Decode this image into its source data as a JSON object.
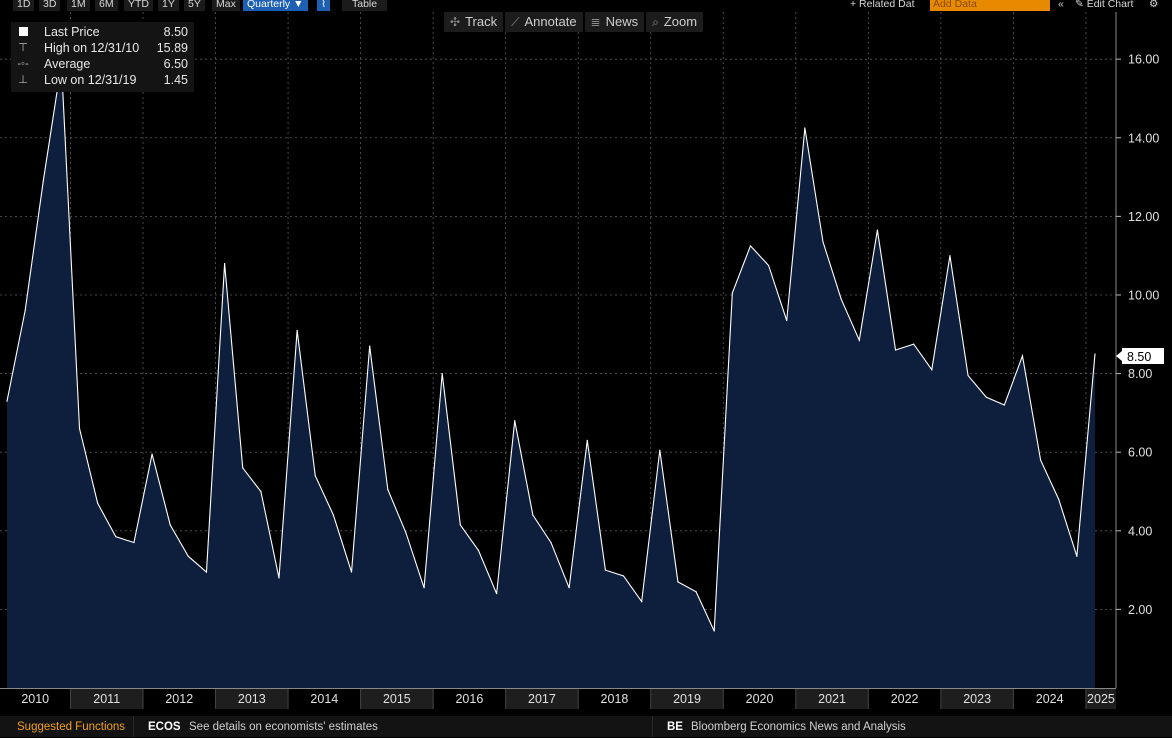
{
  "toolbar": {
    "ranges": [
      "1D",
      "3D",
      "1M",
      "6M",
      "YTD",
      "1Y",
      "5Y",
      "Max"
    ],
    "frequency": "Quarterly ▼",
    "chart_type_icon": "line-chart-icon",
    "table": "Table",
    "related": "+ Related Dat",
    "add_data_placeholder": "Add Data",
    "collapse": "«",
    "edit_chart": "✎ Edit Chart",
    "settings_icon": "gear-icon"
  },
  "chart_tools": [
    {
      "icon": "✣",
      "label": "Track"
    },
    {
      "icon": "⟋",
      "label": "Annotate"
    },
    {
      "icon": "≣",
      "label": "News"
    },
    {
      "icon": "⌕",
      "label": "Zoom"
    }
  ],
  "legend": {
    "last_label": "Last Price",
    "last_value": "8.50",
    "high_label": "High on 12/31/10",
    "high_value": "15.89",
    "avg_label": "Average",
    "avg_value": "6.50",
    "low_label": "Low on 12/31/19",
    "low_value": "1.45"
  },
  "price_tag": "8.50",
  "footer": {
    "suggested": "Suggested Functions",
    "ecos_code": "ECOS",
    "ecos_text": "See details on economists' estimates",
    "be_code": "BE",
    "be_text": "Bloomberg Economics News and Analysis"
  },
  "colors": {
    "line": "#ffffff",
    "fill": "#0d1f3c",
    "accent": "#1d5fb3",
    "add_data": "#e88a00",
    "suggested": "#f0a020"
  },
  "chart_data": {
    "type": "area",
    "ylim": [
      0,
      17.2
    ],
    "y_ticks": [
      2,
      4,
      6,
      8,
      10,
      12,
      14,
      16
    ],
    "y_tick_labels": [
      "2.00",
      "4.00",
      "6.00",
      "8.00",
      "10.00",
      "12.00",
      "14.00",
      "16.00"
    ],
    "year_labels": [
      "2010",
      "2011",
      "2012",
      "2013",
      "2014",
      "2015",
      "2016",
      "2017",
      "2018",
      "2019",
      "2020",
      "2021",
      "2022",
      "2023",
      "2024",
      "2025"
    ],
    "grid": true,
    "series": [
      {
        "values": [
          7.3,
          9.6,
          12.9,
          15.89,
          6.6,
          4.7,
          3.85,
          3.7,
          5.95,
          4.15,
          3.35,
          2.95,
          10.8,
          5.6,
          5.0,
          2.8,
          9.1,
          5.4,
          4.4,
          2.95,
          8.7,
          5.05,
          3.95,
          2.55,
          8.0,
          4.15,
          3.5,
          2.4,
          6.8,
          4.4,
          3.7,
          2.55,
          6.3,
          3.0,
          2.85,
          2.2,
          6.05,
          2.7,
          2.45,
          1.45,
          10.05,
          11.25,
          10.75,
          9.35,
          14.25,
          11.35,
          9.9,
          8.85,
          11.65,
          8.6,
          8.75,
          8.1,
          11.0,
          7.95,
          7.4,
          7.2,
          8.45,
          5.8,
          4.8,
          3.35,
          8.5
        ]
      }
    ]
  }
}
